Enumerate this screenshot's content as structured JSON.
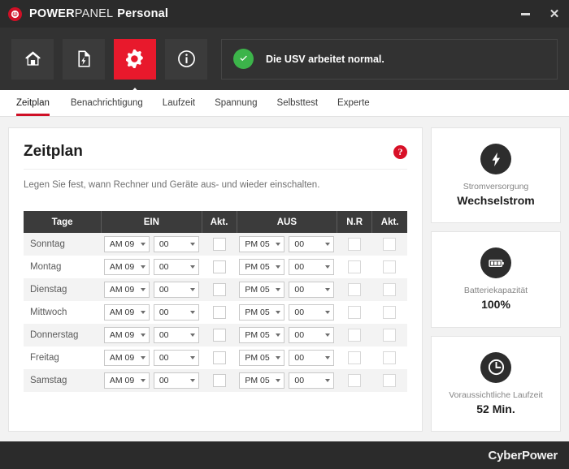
{
  "window": {
    "title_part1": "POWER",
    "title_part2": "PANEL",
    "title_part3": "Personal",
    "brand_icon": "power-logo-icon",
    "minimize_label": "–",
    "close_label": "✕"
  },
  "toolbar": {
    "buttons": [
      {
        "name": "home",
        "icon": "home-icon",
        "active": false
      },
      {
        "name": "logs",
        "icon": "document-power-icon",
        "active": false
      },
      {
        "name": "settings",
        "icon": "gear-icon",
        "active": true
      },
      {
        "name": "info",
        "icon": "info-icon",
        "active": false
      }
    ],
    "status": {
      "icon": "check-circle-icon",
      "text": "Die USV arbeitet normal.",
      "color": "#3cb44a"
    }
  },
  "tabs": [
    {
      "label": "Zeitplan",
      "active": true
    },
    {
      "label": "Benachrichtigung",
      "active": false
    },
    {
      "label": "Laufzeit",
      "active": false
    },
    {
      "label": "Spannung",
      "active": false
    },
    {
      "label": "Selbsttest",
      "active": false
    },
    {
      "label": "Experte",
      "active": false
    }
  ],
  "main": {
    "title": "Zeitplan",
    "help_icon": "help-icon",
    "help_label": "?",
    "description": "Legen Sie fest, wann Rechner und Geräte aus- und wieder einschalten.",
    "table": {
      "headers": [
        "Tage",
        "EIN",
        "Akt.",
        "AUS",
        "N.R",
        "Akt."
      ],
      "rows": [
        {
          "day": "Sonntag",
          "on_ampm": "AM 09",
          "on_min": "00",
          "on_act": false,
          "off_ampm": "PM 05",
          "off_min": "00",
          "nr": false,
          "off_act": false
        },
        {
          "day": "Montag",
          "on_ampm": "AM 09",
          "on_min": "00",
          "on_act": false,
          "off_ampm": "PM 05",
          "off_min": "00",
          "nr": false,
          "off_act": false
        },
        {
          "day": "Dienstag",
          "on_ampm": "AM 09",
          "on_min": "00",
          "on_act": false,
          "off_ampm": "PM 05",
          "off_min": "00",
          "nr": false,
          "off_act": false
        },
        {
          "day": "Mittwoch",
          "on_ampm": "AM 09",
          "on_min": "00",
          "on_act": false,
          "off_ampm": "PM 05",
          "off_min": "00",
          "nr": false,
          "off_act": false
        },
        {
          "day": "Donnerstag",
          "on_ampm": "AM 09",
          "on_min": "00",
          "on_act": false,
          "off_ampm": "PM 05",
          "off_min": "00",
          "nr": false,
          "off_act": false
        },
        {
          "day": "Freitag",
          "on_ampm": "AM 09",
          "on_min": "00",
          "on_act": false,
          "off_ampm": "PM 05",
          "off_min": "00",
          "nr": false,
          "off_act": false
        },
        {
          "day": "Samstag",
          "on_ampm": "AM 09",
          "on_min": "00",
          "on_act": false,
          "off_ampm": "PM 05",
          "off_min": "00",
          "nr": false,
          "off_act": false
        }
      ]
    }
  },
  "rail": {
    "cards": [
      {
        "icon": "bolt-circle-icon",
        "label": "Stromversorgung",
        "value": "Wechselstrom"
      },
      {
        "icon": "battery-circle-icon",
        "label": "Batteriekapazität",
        "value": "100%"
      },
      {
        "icon": "clock-circle-icon",
        "label": "Voraussichtliche Laufzeit",
        "value": "52 Min."
      }
    ]
  },
  "footer": {
    "logo_part1": "Cyber",
    "logo_part2": "Power"
  },
  "colors": {
    "accent_red": "#cf1026",
    "active_red": "#e8192c",
    "status_green": "#3cb44a",
    "chrome_dark": "#2b2b2b",
    "toolbar_dark": "#323232"
  }
}
